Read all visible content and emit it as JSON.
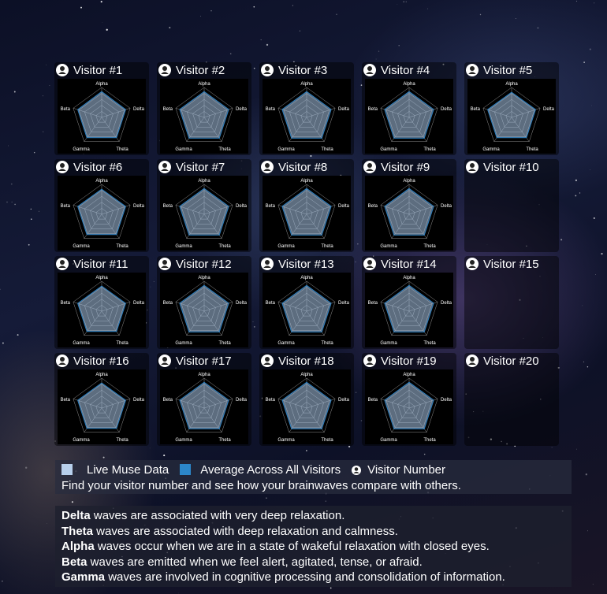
{
  "radar": {
    "axes": [
      "Alpha",
      "Delta",
      "Theta",
      "Gamma",
      "Beta"
    ],
    "colors": {
      "live": "#a9c6e8",
      "average": "#2a7fc0",
      "grid": "#8f8f8f"
    }
  },
  "visitors": [
    {
      "label": "Visitor #1",
      "has_data": true,
      "live": [
        0.86,
        0.84,
        0.84,
        0.84,
        0.84
      ]
    },
    {
      "label": "Visitor #2",
      "has_data": true,
      "live": [
        0.86,
        0.86,
        0.86,
        0.86,
        0.86
      ]
    },
    {
      "label": "Visitor #3",
      "has_data": true,
      "live": [
        0.86,
        0.86,
        0.86,
        0.86,
        0.86
      ]
    },
    {
      "label": "Visitor #4",
      "has_data": true,
      "live": [
        0.86,
        0.86,
        0.86,
        0.86,
        0.86
      ]
    },
    {
      "label": "Visitor #5",
      "has_data": true,
      "live": [
        0.84,
        0.84,
        0.84,
        0.84,
        0.84
      ]
    },
    {
      "label": "Visitor #6",
      "has_data": true,
      "live": [
        0.84,
        0.84,
        0.84,
        0.84,
        0.84
      ]
    },
    {
      "label": "Visitor #7",
      "has_data": true,
      "live": [
        0.86,
        0.86,
        0.86,
        0.86,
        0.86
      ]
    },
    {
      "label": "Visitor #8",
      "has_data": true,
      "live": [
        0.86,
        0.86,
        0.86,
        0.86,
        0.86
      ]
    },
    {
      "label": "Visitor #9",
      "has_data": true,
      "live": [
        0.86,
        0.86,
        0.86,
        0.86,
        0.86
      ]
    },
    {
      "label": "Visitor #10",
      "has_data": false,
      "live": []
    },
    {
      "label": "Visitor #11",
      "has_data": true,
      "live": [
        0.84,
        0.84,
        0.84,
        0.84,
        0.84
      ]
    },
    {
      "label": "Visitor #12",
      "has_data": true,
      "live": [
        0.86,
        0.86,
        0.86,
        0.86,
        0.86
      ]
    },
    {
      "label": "Visitor #13",
      "has_data": true,
      "live": [
        0.86,
        0.86,
        0.86,
        0.86,
        0.86
      ]
    },
    {
      "label": "Visitor #14",
      "has_data": true,
      "live": [
        0.86,
        0.86,
        0.86,
        0.86,
        0.86
      ]
    },
    {
      "label": "Visitor #15",
      "has_data": false,
      "live": []
    },
    {
      "label": "Visitor #16",
      "has_data": true,
      "live": [
        0.84,
        0.84,
        0.84,
        0.84,
        0.84
      ]
    },
    {
      "label": "Visitor #17",
      "has_data": true,
      "live": [
        0.86,
        0.86,
        0.86,
        0.86,
        0.86
      ]
    },
    {
      "label": "Visitor #18",
      "has_data": true,
      "live": [
        0.86,
        0.86,
        0.86,
        0.86,
        0.86
      ]
    },
    {
      "label": "Visitor #19",
      "has_data": true,
      "live": [
        0.86,
        0.86,
        0.86,
        0.86,
        0.86
      ]
    },
    {
      "label": "Visitor #20",
      "has_data": false,
      "live": []
    }
  ],
  "legend": {
    "live_label": "Live Muse Data",
    "average_label": "Average Across All Visitors",
    "visitor_number_label": "Visitor Number",
    "live_color": "#b7d0ec",
    "average_color": "#2c86c8",
    "instruction": "Find your visitor number and see how your brainwaves compare with others."
  },
  "waves": [
    {
      "name": "Delta",
      "text": " waves are associated with very deep relaxation."
    },
    {
      "name": "Theta",
      "text": " waves are associated with deep relaxation and calmness."
    },
    {
      "name": "Alpha",
      "text": " waves occur when we are in a state of wakeful relaxation with closed eyes."
    },
    {
      "name": "Beta",
      "text": " waves are emitted when we feel alert, agitated, tense, or afraid."
    },
    {
      "name": "Gamma",
      "text": " waves are involved in cognitive processing and consolidation of information."
    }
  ]
}
